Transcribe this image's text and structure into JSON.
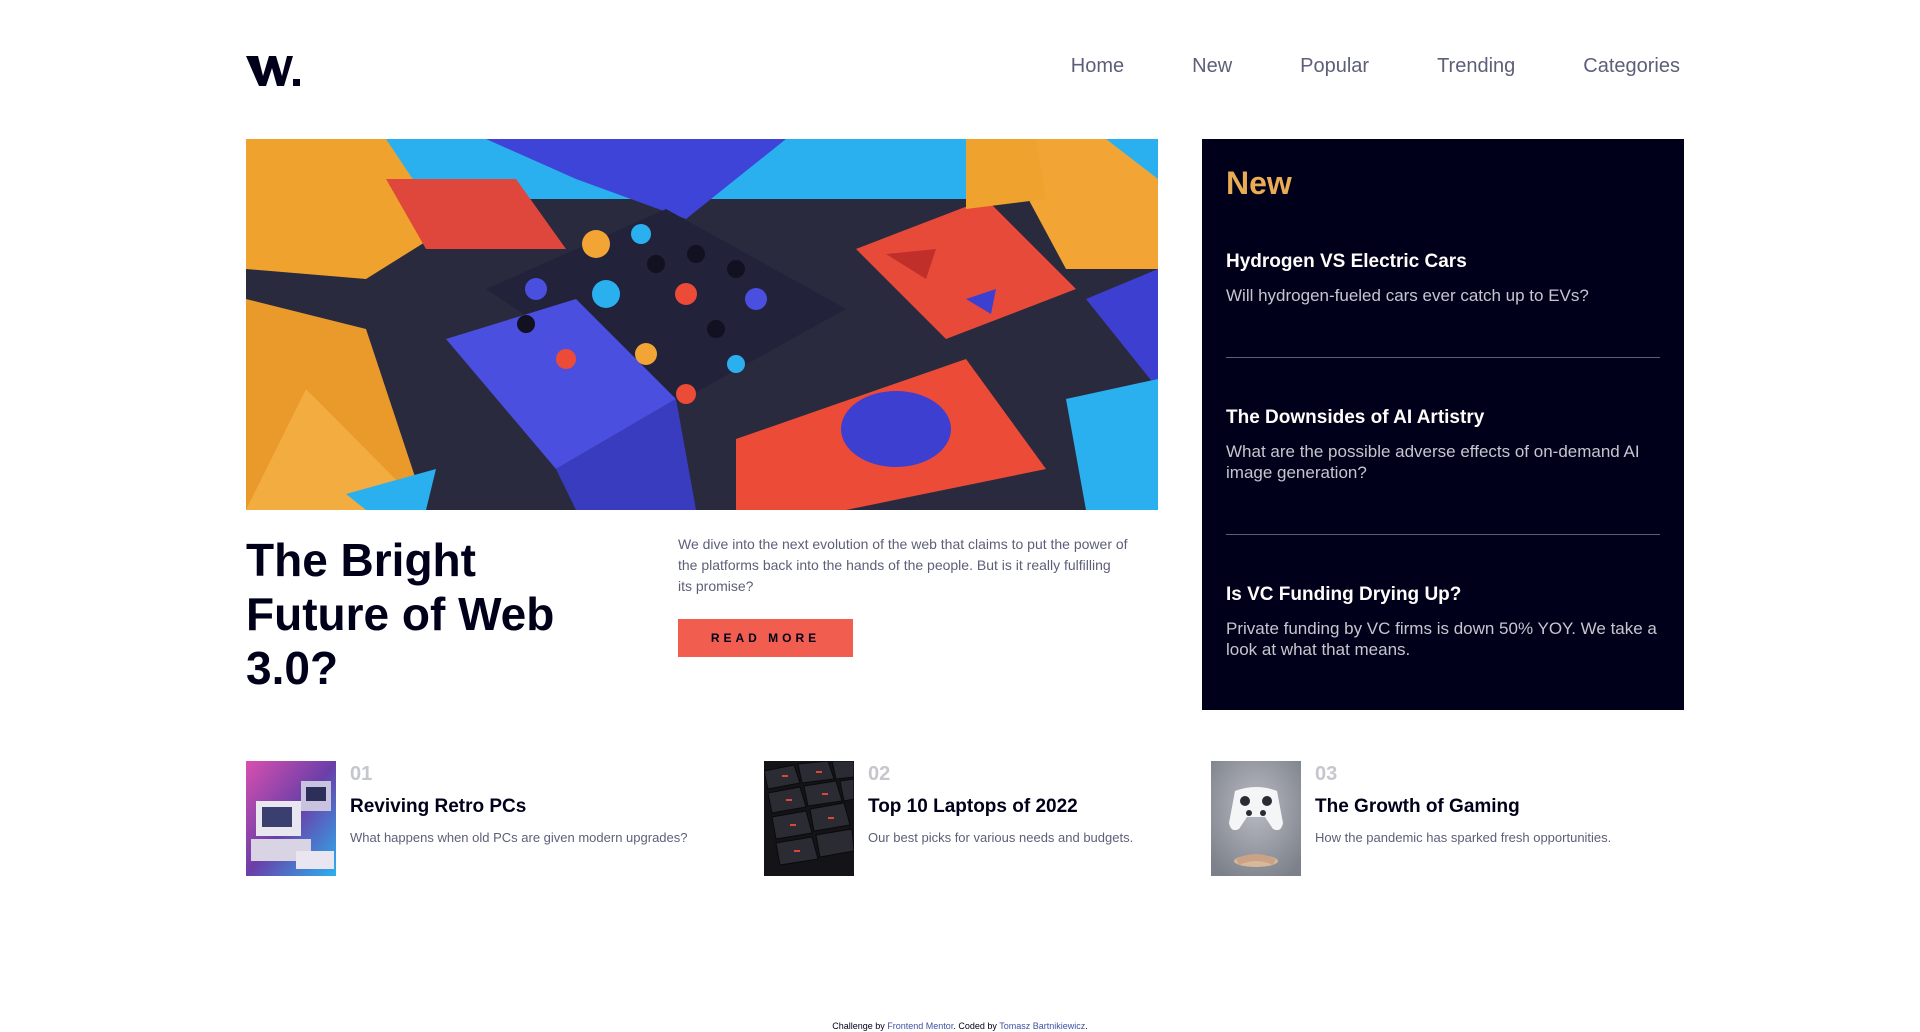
{
  "logo": {
    "text": "W"
  },
  "nav": {
    "items": [
      "Home",
      "New",
      "Popular",
      "Trending",
      "Categories"
    ]
  },
  "hero": {
    "title": "The Bright Future of Web 3.0?",
    "description": "We dive into the next evolution of the web that claims to put the power of the platforms back into the hands of the people. But is it really fulfilling its promise?",
    "button_label": "READ MORE"
  },
  "new_panel": {
    "heading": "New",
    "items": [
      {
        "title": "Hydrogen VS Electric Cars",
        "desc": "Will hydrogen-fueled cars ever catch up to EVs?"
      },
      {
        "title": "The Downsides of AI Artistry",
        "desc": "What are the possible adverse effects of on-demand AI image generation?"
      },
      {
        "title": "Is VC Funding Drying Up?",
        "desc": "Private funding by VC firms is down 50% YOY. We take a look at what that means."
      }
    ]
  },
  "articles": [
    {
      "num": "01",
      "title": "Reviving Retro PCs",
      "desc": "What happens when old PCs are given modern upgrades?"
    },
    {
      "num": "02",
      "title": "Top 10 Laptops of 2022",
      "desc": "Our best picks for various needs and budgets."
    },
    {
      "num": "03",
      "title": "The Growth of Gaming",
      "desc": "How the pandemic has sparked fresh opportunities."
    }
  ],
  "footer": {
    "prefix": "Challenge by ",
    "link1": "Frontend Mentor",
    "middle": ". Coded by ",
    "link2": "Tomasz Bartnikiewicz",
    "suffix": "."
  },
  "colors": {
    "accent_red": "#f15e50",
    "accent_orange": "#e9ab53",
    "dark_navy": "#00001a",
    "grayish_blue": "#5d5f79"
  }
}
